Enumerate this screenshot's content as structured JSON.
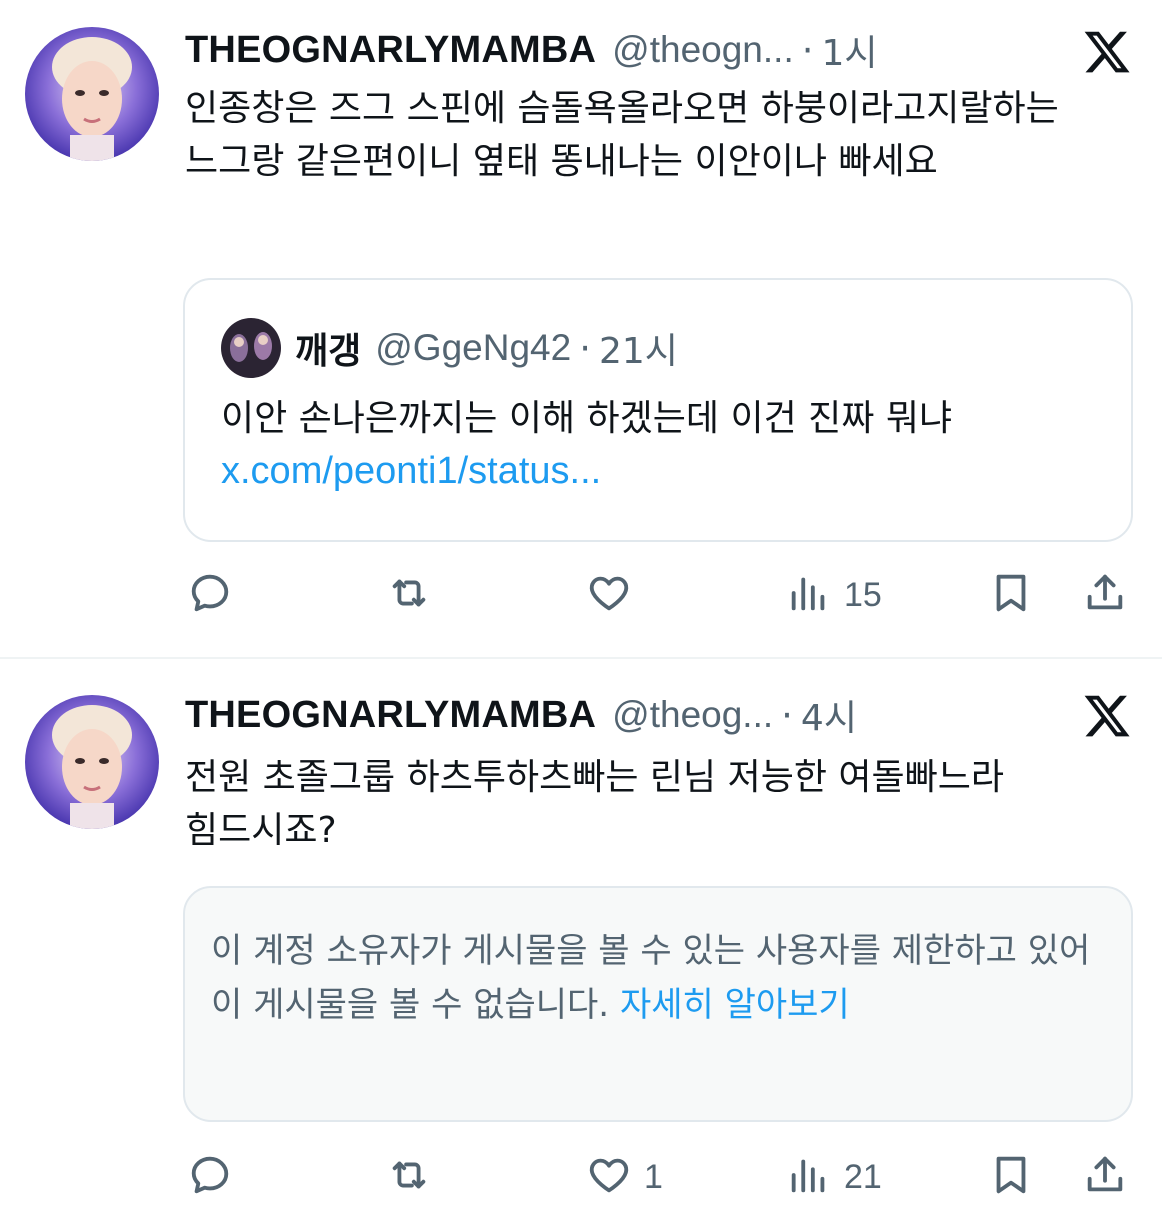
{
  "tweets": [
    {
      "display_name": "THEOGNARLYMAMBA",
      "handle": "@theogn...",
      "separator": "·",
      "time": "1시",
      "text": "인종창은 즈그 스핀에 슴돌욕올라오면 하붕이라고지랄하는 느그랑 같은편이니 옆태 똥내나는 이안이나 빠세요",
      "quote": {
        "display_name": "깨갱",
        "handle": "@GgeNg42",
        "separator": "·",
        "time": "21시",
        "text": "이안 손나은까지는 이해 하겠는데 이건 진짜 뭐냐",
        "link": "x.com/peonti1/status..."
      },
      "actions": {
        "reply": "",
        "retweet": "",
        "like": "",
        "views": "15"
      }
    },
    {
      "display_name": "THEOGNARLYMAMBA",
      "handle": "@theog...",
      "separator": "·",
      "time": "4시",
      "text": "전원 초졸그룹 하츠투하츠빠는 린님 저능한 여돌빠느라 힘드시죠?",
      "restricted": {
        "text": "이 계정 소유자가 게시물을 볼 수 있는 사용자를 제한하고 있어 이 게시물을 볼 수 없습니다.",
        "link": "자세히 알아보기"
      },
      "actions": {
        "reply": "",
        "retweet": "",
        "like": "1",
        "views": "21"
      }
    }
  ],
  "icons": {
    "x_logo": "x-logo-icon",
    "reply": "reply-icon",
    "retweet": "retweet-icon",
    "like": "heart-icon",
    "views": "views-icon",
    "bookmark": "bookmark-icon",
    "share": "share-icon"
  },
  "colors": {
    "text": "#0f1419",
    "secondary": "#536471",
    "link": "#1d9bf0",
    "border": "#e1e8ed"
  }
}
